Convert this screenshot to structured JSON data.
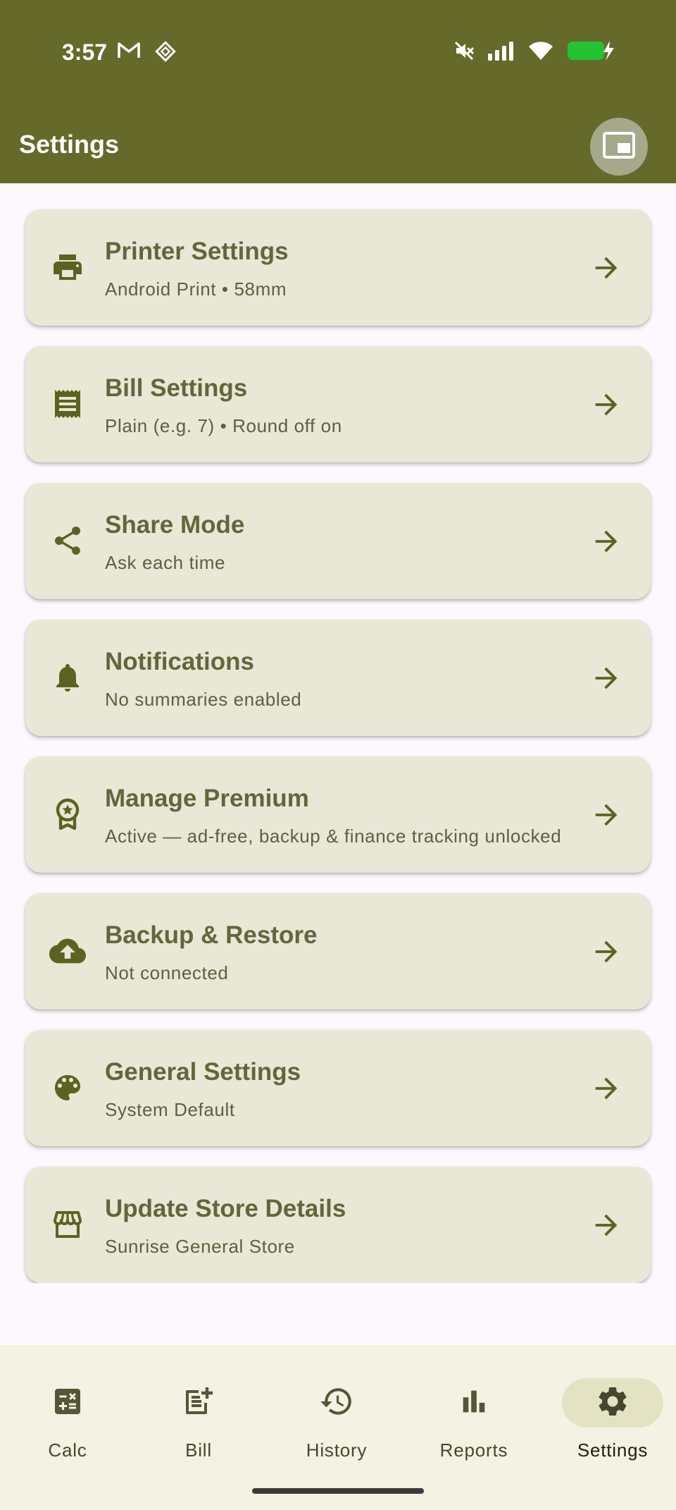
{
  "status_bar": {
    "time": "3:57",
    "left_icons": [
      "gmail-icon",
      "app-diamond-icon"
    ],
    "right_icons": [
      "mute-icon",
      "signal-icon",
      "wifi-icon",
      "battery-charging-icon"
    ]
  },
  "header": {
    "title": "Settings",
    "action_icon": "picture-in-picture-icon"
  },
  "colors": {
    "app_bar": "#65692a",
    "accent": "#5c6320",
    "card_bg": "#e9e7d6",
    "battery": "#22c232"
  },
  "settings": [
    {
      "icon": "printer-icon",
      "title": "Printer Settings",
      "subtitle": "Android Print • 58mm"
    },
    {
      "icon": "receipt-icon",
      "title": "Bill Settings",
      "subtitle": "Plain (e.g. 7) • Round off on"
    },
    {
      "icon": "share-icon",
      "title": "Share Mode",
      "subtitle": "Ask each time"
    },
    {
      "icon": "bell-icon",
      "title": "Notifications",
      "subtitle": "No summaries enabled"
    },
    {
      "icon": "premium-badge-icon",
      "title": "Manage Premium",
      "subtitle": "Active — ad-free, backup & finance tracking unlocked"
    },
    {
      "icon": "cloud-upload-icon",
      "title": "Backup & Restore",
      "subtitle": "Not connected"
    },
    {
      "icon": "palette-icon",
      "title": "General Settings",
      "subtitle": "System Default"
    },
    {
      "icon": "storefront-icon",
      "title": "Update Store Details",
      "subtitle": "Sunrise General Store"
    }
  ],
  "bottom_nav": {
    "items": [
      {
        "label": "Calc",
        "icon": "calculator-icon",
        "active": false
      },
      {
        "label": "Bill",
        "icon": "bill-add-icon",
        "active": false
      },
      {
        "label": "History",
        "icon": "history-icon",
        "active": false
      },
      {
        "label": "Reports",
        "icon": "bar-chart-icon",
        "active": false
      },
      {
        "label": "Settings",
        "icon": "gear-icon",
        "active": true
      }
    ]
  }
}
